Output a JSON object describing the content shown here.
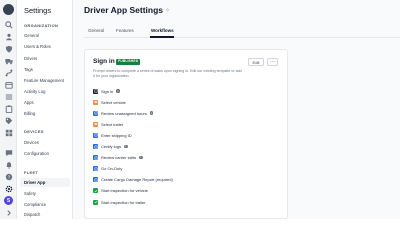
{
  "colors": {
    "badge_green": "#15803d",
    "step_orange": "#ea8c55",
    "step_blue": "#2563eb",
    "step_green": "#16a34a",
    "step_black": "#111827",
    "avatar_purple": "#4f46e5"
  },
  "rail": {
    "icons": [
      "brand-logo",
      "search-icon",
      "people-icon",
      "shield-icon",
      "truck-icon",
      "route-icon",
      "calendar-icon",
      "list-icon",
      "clipboard-icon",
      "tag-icon",
      "grid-icon",
      "bell-icon",
      "chat-icon",
      "help-icon",
      "settings-icon"
    ],
    "avatar_initial": "S"
  },
  "sidebar": {
    "title": "Settings",
    "sections": [
      {
        "label": "ORGANIZATION",
        "items": [
          "General",
          "Users & Roles",
          "Drivers",
          "Tags",
          "Feature Management",
          "Activity Log",
          "Apps",
          "Billing"
        ]
      },
      {
        "label": "DEVICES",
        "items": [
          "Devices",
          "Configuration"
        ]
      },
      {
        "label": "FLEET",
        "items": [
          "Driver App",
          "Safety",
          "Compliance",
          "Dispatch"
        ]
      }
    ],
    "active": "Driver App"
  },
  "main": {
    "title": "Driver App Settings",
    "tabs": [
      "General",
      "Features",
      "Workflows"
    ],
    "active_tab": "Workflows",
    "card": {
      "title": "Sign in",
      "badge": "PUBLISHED",
      "edit_label": "Edit",
      "more_label": "···",
      "description": "Prompt drivers to complete a series of tasks upon signing in. Edit our existing template or add it for your organization.",
      "steps": [
        {
          "label": "Sign in",
          "color": "black",
          "info": true
        },
        {
          "label": "Select vehicle",
          "color": "orange",
          "info": false
        },
        {
          "label": "Review unassigned hours",
          "color": "blue",
          "info": true
        },
        {
          "label": "Select trailer",
          "color": "orange",
          "info": false
        },
        {
          "label": "Enter shipping ID",
          "color": "blue",
          "info": false
        },
        {
          "label": "Certify logs",
          "color": "blue",
          "info": true
        },
        {
          "label": "Review carrier edits",
          "color": "blue",
          "info": true
        },
        {
          "label": "Go On-Duty",
          "color": "blue",
          "info": false
        },
        {
          "label": "Create Cargo Damage Report (required)",
          "color": "blue",
          "info": false
        },
        {
          "label": "Start inspection for vehicle",
          "color": "green",
          "info": false
        },
        {
          "label": "Start inspection for trailer",
          "color": "green",
          "info": false
        }
      ]
    }
  }
}
